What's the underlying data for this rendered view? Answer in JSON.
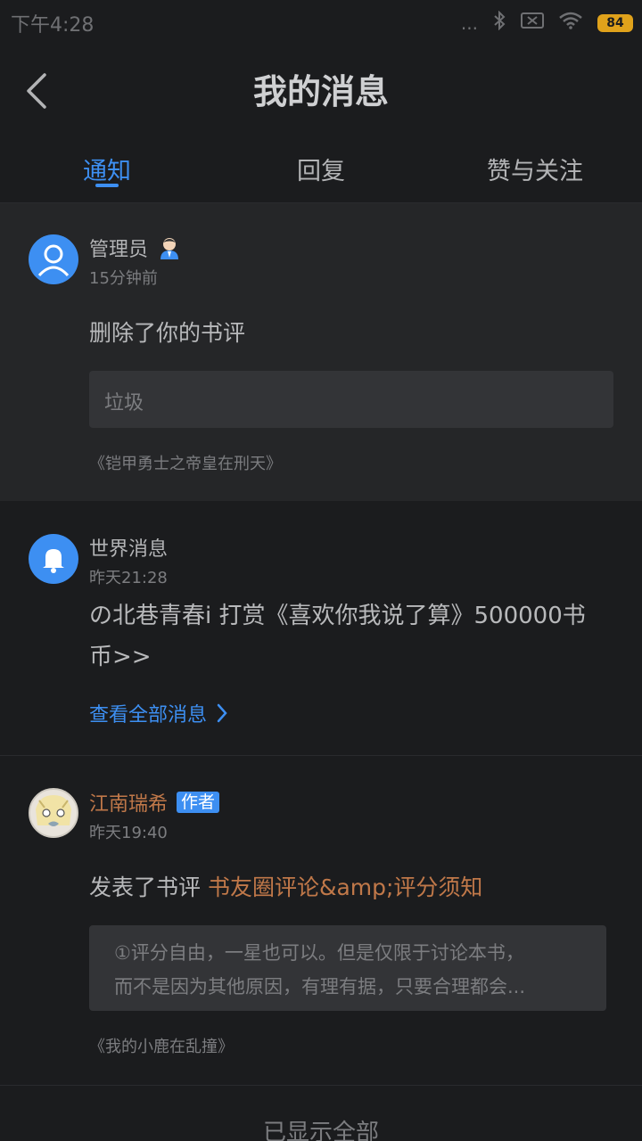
{
  "status_bar": {
    "time": "下午4:28",
    "dots": "...",
    "battery": "84"
  },
  "header": {
    "title": "我的消息"
  },
  "tabs": [
    {
      "label": "通知",
      "active": true
    },
    {
      "label": "回复",
      "active": false
    },
    {
      "label": "赞与关注",
      "active": false
    }
  ],
  "messages": [
    {
      "name": "管理员",
      "time": "15分钟前",
      "action": "删除了你的书评",
      "quote": "垃圾",
      "book": "《铠甲勇士之帝皇在刑天》"
    },
    {
      "name": "世界消息",
      "time": "昨天21:28",
      "content_line1": "の北巷青春i 打赏《喜欢你我说了算》500000书",
      "content_line2": "币>>",
      "link": "查看全部消息"
    },
    {
      "name": "江南瑞希",
      "badge": "作者",
      "time": "昨天19:40",
      "action_prefix": "发表了书评",
      "action_link": "书友圈评论&amp;评分须知",
      "quote_line1": "①评分自由，一星也可以。但是仅限于讨论本书，",
      "quote_line2": "而不是因为其他原因，有理有据，只要合理都会...",
      "book": "《我的小鹿在乱撞》"
    }
  ],
  "footer": "已显示全部",
  "colors": {
    "accent": "#3d8ff2",
    "author_name": "#c07849",
    "battery": "#e0a21b"
  },
  "icons": [
    "back-arrow-icon",
    "user-avatar-icon",
    "admin-badge-icon",
    "bell-icon",
    "chevron-right-icon",
    "bluetooth-icon",
    "sim-icon",
    "wifi-icon",
    "battery-icon"
  ]
}
